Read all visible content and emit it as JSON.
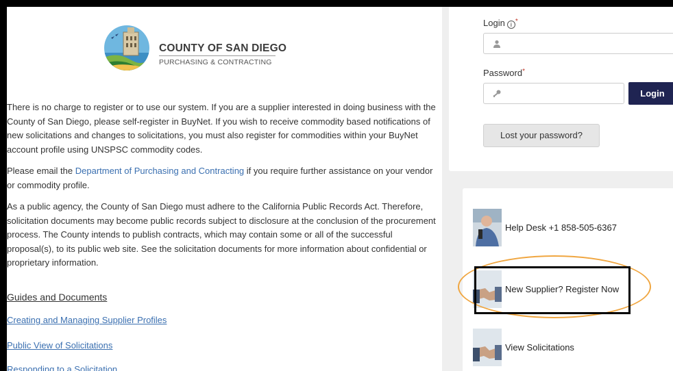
{
  "logo": {
    "org_name": "COUNTY OF SAN DIEGO",
    "department": "PURCHASING & CONTRACTING"
  },
  "intro": {
    "p1": "There is no charge to register or to use our system. If you are a supplier interested in doing business with the County of San Diego, please self-register in BuyNet. If you wish to receive commodity based notifications of new solicitations and changes to solicitations, you must also register for commodities within your BuyNet account profile using UNSPSC commodity codes.",
    "p2_before": "Please email the ",
    "p2_link": "Department of Purchasing and Contracting",
    "p2_after": " if you require further assistance on your vendor or commodity profile.",
    "p3": "As a public agency, the County of San Diego must adhere to the California Public Records Act. Therefore, solicitation documents may become public records subject to disclosure at the conclusion of the procurement process. The County intends to publish contracts, which may contain some or all of the successful proposal(s), to its public web site. See the solicitation documents for more information about confidential or proprietary information."
  },
  "guides": {
    "heading": "Guides and Documents",
    "links": [
      "Creating and Managing Supplier Profiles",
      "Public View of Solicitations",
      "Responding to a Solicitation"
    ]
  },
  "login_form": {
    "login_label": "Login",
    "password_label": "Password",
    "required_mark": "*",
    "info_mark": "i",
    "login_button": "Login",
    "lost_password_button": "Lost your password?"
  },
  "quick_links": [
    {
      "label": "Help Desk +1 858-505-6367",
      "icon": "help-desk-photo"
    },
    {
      "label": "New Supplier? Register Now",
      "icon": "handshake-photo"
    },
    {
      "label": "View Solicitations",
      "icon": "handshake-photo"
    }
  ],
  "annotations": {
    "highlight_color": "#f0a640",
    "box_color": "#000000"
  },
  "colors": {
    "login_button_bg": "#1f2452",
    "link": "#3a6fb0"
  }
}
